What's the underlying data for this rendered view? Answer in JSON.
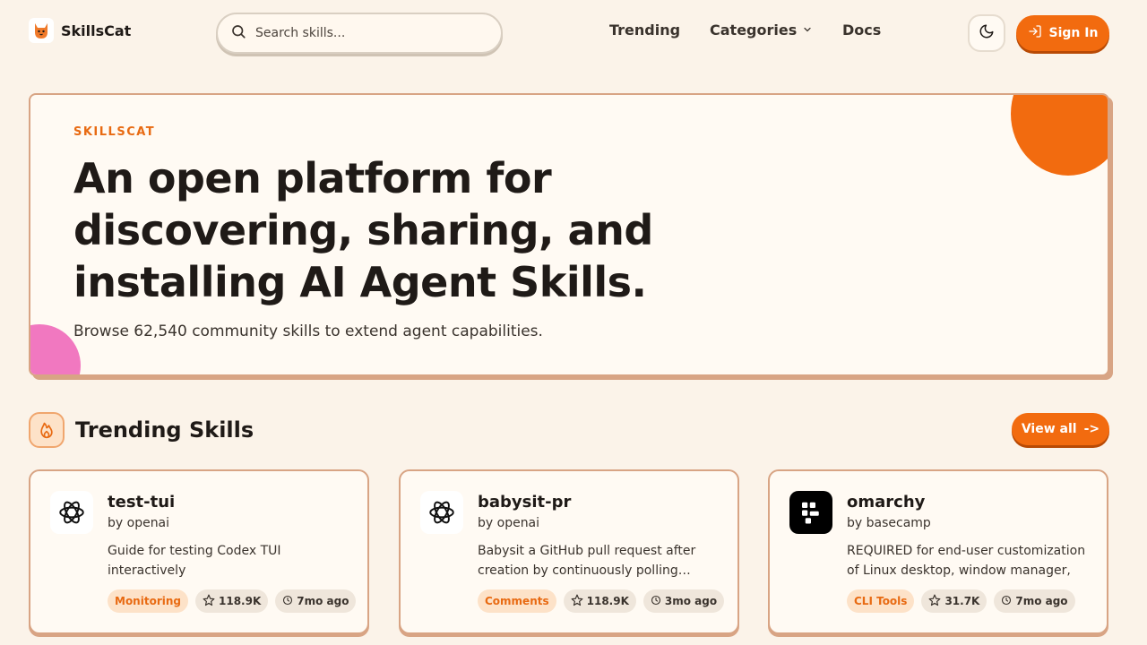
{
  "header": {
    "brand": "SkillsCat",
    "search_placeholder": "Search skills...",
    "nav": {
      "trending": "Trending",
      "categories": "Categories",
      "docs": "Docs"
    },
    "sign_in": "Sign In"
  },
  "hero": {
    "eyebrow": "SKILLSCAT",
    "title": "An open platform for discovering, sharing, and installing AI Agent Skills.",
    "subtitle": "Browse 62,540 community skills to extend agent capabilities."
  },
  "trending": {
    "title": "Trending Skills",
    "view_all": "View all",
    "view_all_arrow": "->",
    "cards": [
      {
        "name": "test-tui",
        "author": "by openai",
        "description": "Guide for testing Codex TUI interactively",
        "category": "Monitoring",
        "stars": "118.9K",
        "updated": "7mo ago",
        "avatar_icon": "openai-logo-icon"
      },
      {
        "name": "babysit-pr",
        "author": "by openai",
        "description": "Babysit a GitHub pull request after creation by continuously polling…",
        "category": "Comments",
        "stars": "118.9K",
        "updated": "3mo ago",
        "avatar_icon": "openai-logo-icon"
      },
      {
        "name": "omarchy",
        "author": "by basecamp",
        "description": "REQUIRED for end-user customization of Linux desktop, window manager, or…",
        "category": "CLI Tools",
        "stars": "31.7K",
        "updated": "7mo ago",
        "avatar_icon": "omarchy-logo-icon"
      }
    ]
  },
  "colors": {
    "accent": "#f26b0f",
    "background": "#fbf3e9",
    "border": "#d8a484",
    "pink": "#f178c0"
  }
}
